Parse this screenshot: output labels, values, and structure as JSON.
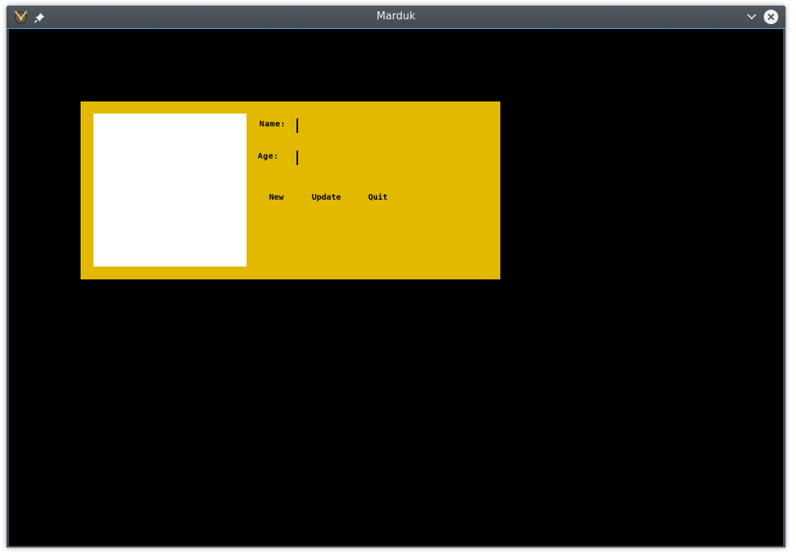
{
  "window": {
    "title": "Marduk"
  },
  "form": {
    "name_label": "Name:",
    "name_value": "",
    "age_label": "Age:",
    "age_value": ""
  },
  "buttons": {
    "new_label": "New",
    "update_label": "Update",
    "quit_label": "Quit"
  },
  "colors": {
    "panel": "#e2b800",
    "background": "#000000",
    "canvas": "#ffffff",
    "accent": "#3daee9"
  },
  "icons": {
    "app": "marduk-app-icon",
    "pin": "pin-icon",
    "minimize": "chevron-down-icon",
    "close": "close-icon"
  }
}
